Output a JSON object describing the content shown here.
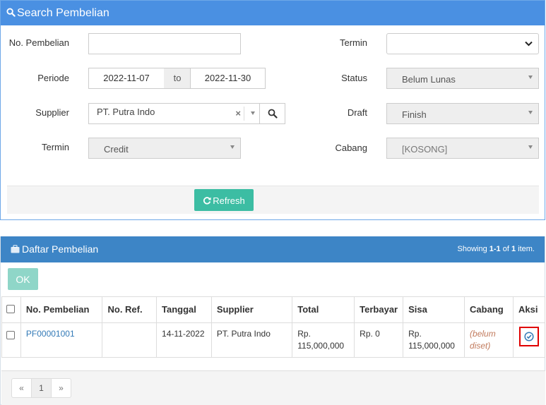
{
  "search": {
    "title": "Search Pembelian",
    "labels": {
      "no_pembelian": "No. Pembelian",
      "periode": "Periode",
      "supplier": "Supplier",
      "termin_left": "Termin",
      "termin_right": "Termin",
      "status": "Status",
      "draft": "Draft",
      "cabang": "Cabang"
    },
    "values": {
      "no_pembelian": "",
      "date_from": "2022-11-07",
      "date_sep": "to",
      "date_to": "2022-11-30",
      "supplier": "PT. Putra Indo",
      "termin_left": "Credit",
      "termin_right": "",
      "status": "Belum Lunas",
      "draft": "Finish",
      "cabang": "[KOSONG]"
    },
    "refresh_label": "Refresh"
  },
  "list": {
    "title": "Daftar Pembelian",
    "summary_prefix": "Showing ",
    "summary_range": "1-1",
    "summary_mid": " of ",
    "summary_total": "1",
    "summary_suffix": " item.",
    "ok_label": "OK",
    "columns": [
      "No. Pembelian",
      "No. Ref.",
      "Tanggal",
      "Supplier",
      "Total",
      "Terbayar",
      "Sisa",
      "Cabang",
      "Aksi"
    ],
    "rows": [
      {
        "no_pembelian": "PF00001001",
        "no_ref": "",
        "tanggal": "14-11-2022",
        "supplier": "PT. Putra Indo",
        "total_1": "Rp.",
        "total_2": "115,000,000",
        "terbayar": "Rp. 0",
        "sisa_1": "Rp.",
        "sisa_2": "115,000,000",
        "cabang_1": "(belum",
        "cabang_2": "diset)"
      }
    ],
    "pager": {
      "prev": "«",
      "page": "1",
      "next": "»"
    }
  },
  "colors": {
    "search_header": "#4a90e2",
    "list_header": "#3d85c6",
    "refresh": "#3cbda3",
    "ok": "#8fd6c8",
    "highlight": "#e00000"
  }
}
